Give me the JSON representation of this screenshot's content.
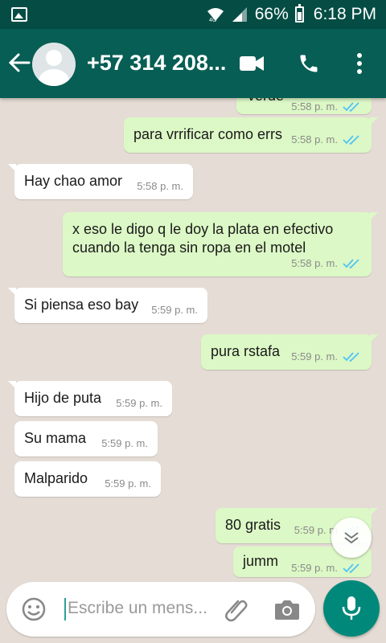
{
  "status_bar": {
    "battery": "66%",
    "time": "6:18 PM"
  },
  "header": {
    "contact_name": "+57 314 208..."
  },
  "messages": [
    {
      "direction": "out",
      "text": "verde",
      "time": "5:58 p. m.",
      "read": true
    },
    {
      "direction": "out",
      "text": "para vrrificar como errs",
      "time": "5:58 p. m.",
      "read": true
    },
    {
      "direction": "in",
      "text": "Hay chao amor",
      "time": "5:58 p. m."
    },
    {
      "direction": "out",
      "text_line1": "x eso le digo q le doy la plata en efectivo",
      "text_line2": "cuando la tenga sin ropa en el motel",
      "time": "5:58 p. m.",
      "read": true
    },
    {
      "direction": "in",
      "text": "Si piensa eso bay",
      "time": "5:59 p. m."
    },
    {
      "direction": "out",
      "text": "pura rstafa",
      "time": "5:59 p. m.",
      "read": true
    },
    {
      "direction": "in",
      "text": "Hijo de puta",
      "time": "5:59 p. m."
    },
    {
      "direction": "in",
      "text": "Su mama",
      "time": "5:59 p. m."
    },
    {
      "direction": "in",
      "text": "Malparido",
      "time": "5:59 p. m."
    },
    {
      "direction": "out",
      "text": "80 gratis",
      "time": "5:59 p. m",
      "read": true
    },
    {
      "direction": "out",
      "text": "jumm",
      "time": "5:59 p. m.",
      "read": true
    }
  ],
  "composer": {
    "placeholder": "Escribe un mens..."
  },
  "colors": {
    "header": "#075e54",
    "status_bar": "#054d44",
    "outgoing_bubble": "#dcf8c6",
    "incoming_bubble": "#ffffff",
    "read_ticks": "#4fc3f7",
    "fab": "#00897b"
  },
  "icons": [
    "gallery-icon",
    "wifi-icon",
    "signal-icon",
    "battery-icon",
    "back-arrow-icon",
    "avatar-icon",
    "video-call-icon",
    "phone-icon",
    "more-vert-icon",
    "scroll-down-icon",
    "emoji-icon",
    "attach-icon",
    "camera-icon",
    "mic-icon"
  ]
}
